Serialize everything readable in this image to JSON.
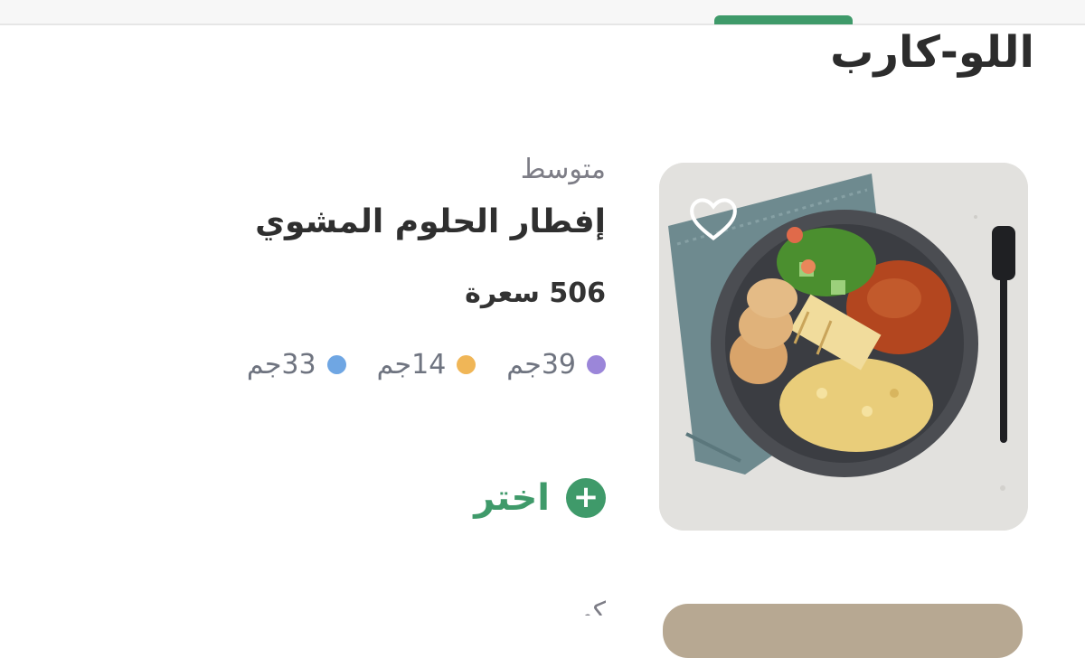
{
  "section": {
    "title": "اللو-كارب"
  },
  "card": {
    "difficulty": "متوسط",
    "name": "إفطار الحلوم المشوي",
    "calories": "506 سعرة",
    "macros": [
      {
        "label": "39جم",
        "color": "#9b86d9"
      },
      {
        "label": "14جم",
        "color": "#f0b657"
      },
      {
        "label": "33جم",
        "color": "#6fa6e3"
      }
    ],
    "select_label": "اختر",
    "favorite_icon": "heart-icon",
    "add_icon": "plus-icon"
  },
  "next_card": {
    "label": "كي"
  },
  "colors": {
    "accent": "#3f9a6a"
  }
}
